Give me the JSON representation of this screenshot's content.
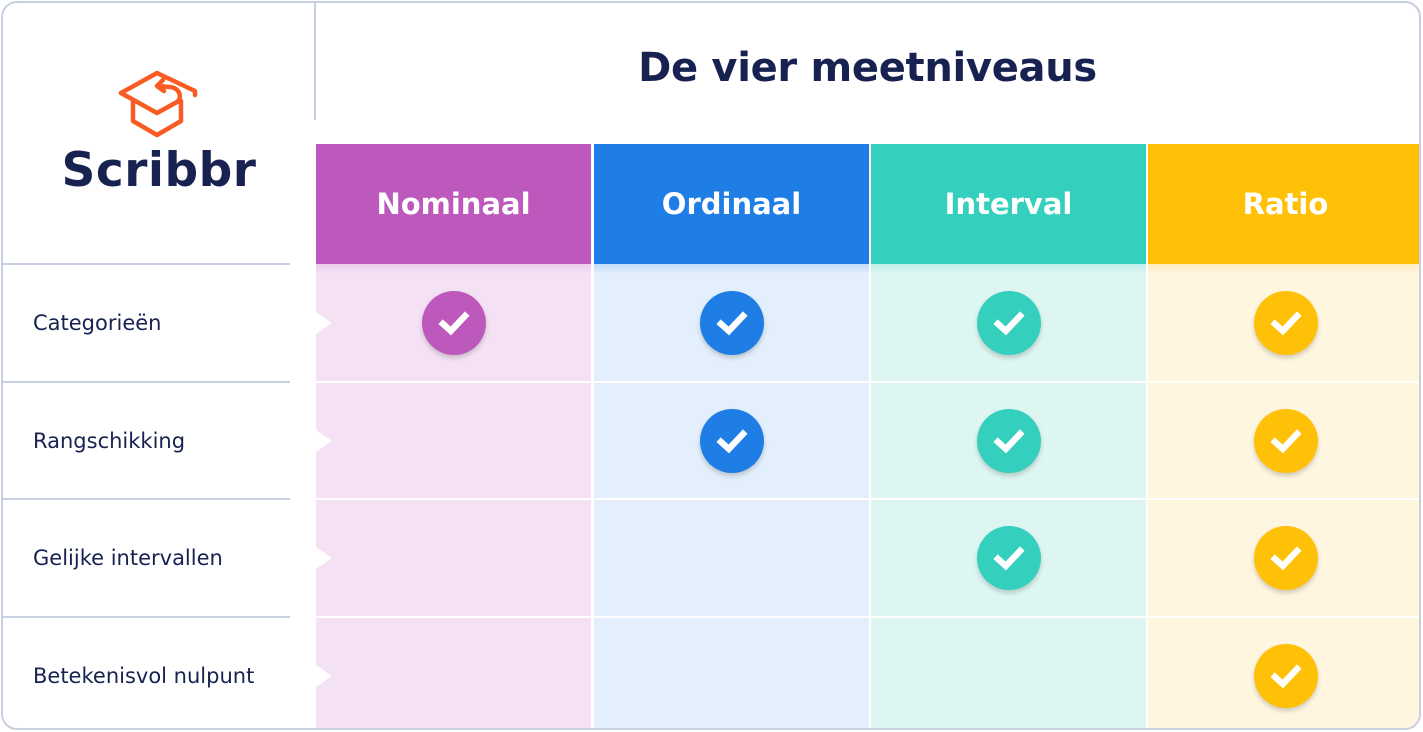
{
  "brand": {
    "name": "Scribbr",
    "logo_icon": "graduation-cap-icon",
    "logo_color": "#fa5b22",
    "text_color": "#172251"
  },
  "title": "De vier meetniveaus",
  "columns": [
    {
      "key": "nominaal",
      "label": "Nominaal",
      "color": "#bd59bd",
      "light": "#f4e2f4"
    },
    {
      "key": "ordinaal",
      "label": "Ordinaal",
      "color": "#1f7ee6",
      "light": "#e3effc"
    },
    {
      "key": "interval",
      "label": "Interval",
      "color": "#35d0bd",
      "light": "#ddf6f2"
    },
    {
      "key": "ratio",
      "label": "Ratio",
      "color": "#ffc107",
      "light": "#fff6e0"
    }
  ],
  "rows": [
    {
      "label": "Categorieën",
      "checks": [
        true,
        true,
        true,
        true
      ]
    },
    {
      "label": "Rangschikking",
      "checks": [
        false,
        true,
        true,
        true
      ]
    },
    {
      "label": "Gelijke intervallen",
      "checks": [
        false,
        false,
        true,
        true
      ]
    },
    {
      "label": "Betekenisvol nulpunt",
      "checks": [
        false,
        false,
        false,
        true
      ]
    }
  ],
  "check_icon": "checkmark-circle-icon"
}
